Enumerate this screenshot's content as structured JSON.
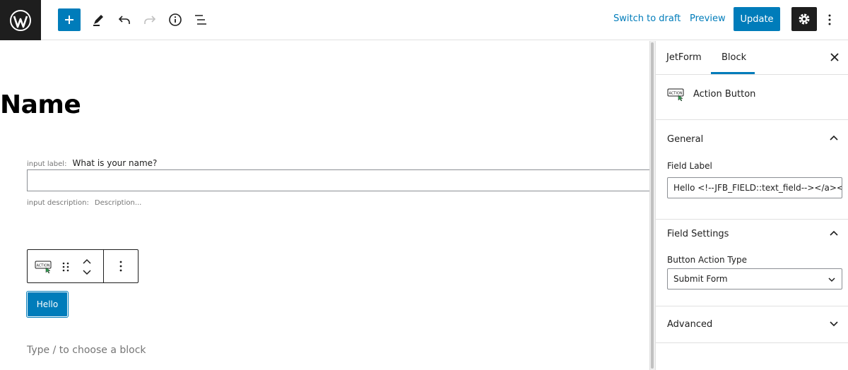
{
  "header": {
    "switch_to_draft_label": "Switch to draft",
    "preview_label": "Preview",
    "update_label": "Update",
    "colors": {
      "accent": "#007cba",
      "dark": "#1e1e1e"
    }
  },
  "editor": {
    "post_title": "Name",
    "field": {
      "label_meta": "input label:",
      "label_text": "What is your name?",
      "description_meta": "input description:",
      "description_placeholder": "Description..."
    },
    "block_toolbar": {
      "block_icon_text": "ACTION"
    },
    "action_button_label": "Hello",
    "appender_placeholder": "Type / to choose a block"
  },
  "sidebar": {
    "tabs": [
      {
        "label": "JetForm",
        "active": false
      },
      {
        "label": "Block",
        "active": true
      }
    ],
    "block_card": {
      "icon_text": "ACTION",
      "title": "Action Button"
    },
    "panels": {
      "general": {
        "title": "General",
        "field_label_label": "Field Label",
        "field_label_value": "Hello <!--JFB_FIELD::text_field--></a></a>"
      },
      "field_settings": {
        "title": "Field Settings",
        "action_type_label": "Button Action Type",
        "action_type_value": "Submit Form"
      },
      "advanced": {
        "title": "Advanced"
      }
    }
  }
}
